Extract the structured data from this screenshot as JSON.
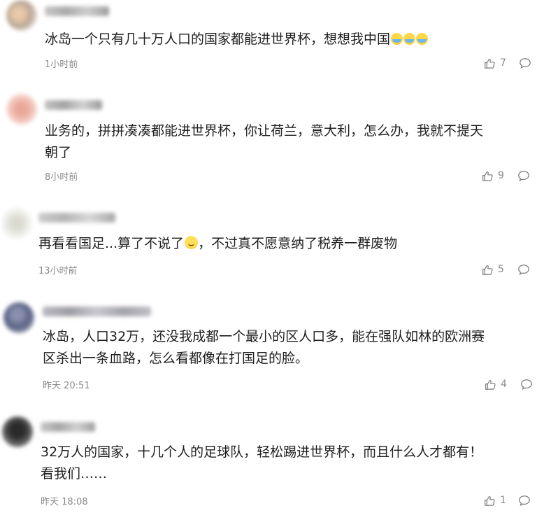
{
  "comments": [
    {
      "text": "冰岛一个只有几十万人口的国家都能进世界杯，想想我中国",
      "emojis": [
        "laugh",
        "laugh",
        "laugh"
      ],
      "time": "1小时前",
      "likes": "7"
    },
    {
      "line1": "业务的，拼拼凑凑都能进世界杯，你让荷兰，意大利，怎么办，我就不提天",
      "line2": "朝了",
      "time": "8小时前",
      "likes": "9"
    },
    {
      "text_a": "再看看国足...算了不说了",
      "emoji": "smile",
      "text_b": "，不过真不愿意纳了税养一群废物",
      "time": "13小时前",
      "likes": "5"
    },
    {
      "line1": "冰岛，人口32万，还没我成都一个最小的区人口多，能在强队如林的欧洲赛",
      "line2": "区杀出一条血路，怎么看都像在打国足的脸。",
      "time": "昨天 20:51",
      "likes": "4"
    },
    {
      "line1": "32万人的国家，十几个人的足球队，轻松踢进世界杯，而且什么人才都有！",
      "line2": "看我们……",
      "time": "昨天 18:08",
      "likes": "1"
    }
  ],
  "colors": {
    "text": "#1f1f1f",
    "meta": "#8a8a8a",
    "background": "#ffffff"
  },
  "icons": [
    "thumbs-up-icon",
    "comment-bubble-icon"
  ]
}
